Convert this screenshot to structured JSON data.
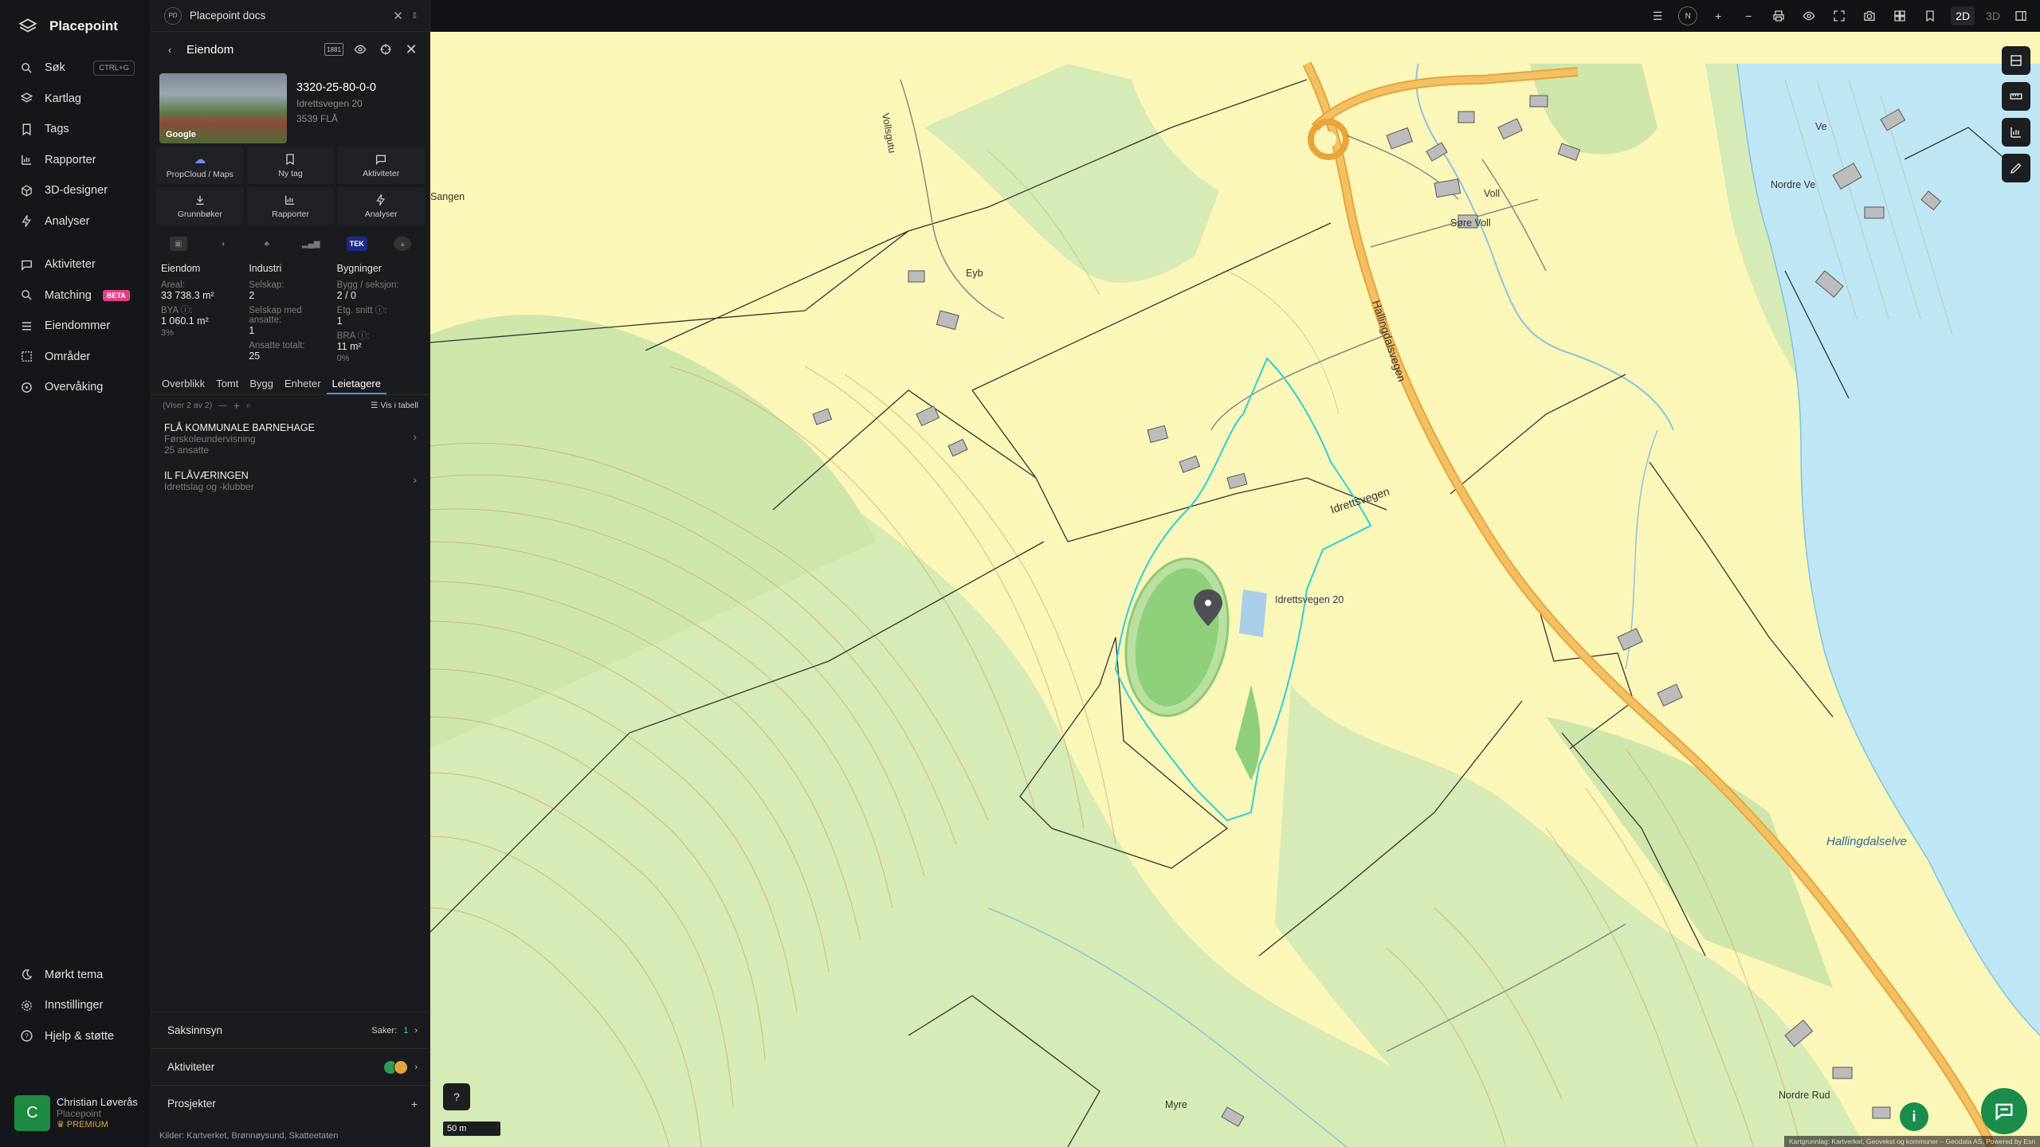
{
  "app": {
    "name": "Placepoint"
  },
  "nav": {
    "items": [
      {
        "label": "Søk",
        "shortcut": "CTRL+G"
      },
      {
        "label": "Kartlag"
      },
      {
        "label": "Tags"
      },
      {
        "label": "Rapporter"
      },
      {
        "label": "3D-designer"
      },
      {
        "label": "Analyser"
      },
      {
        "label": "Aktiviteter"
      },
      {
        "label": "Matching",
        "badge": "BETA"
      },
      {
        "label": "Eiendommer"
      },
      {
        "label": "Områder"
      },
      {
        "label": "Overvåking"
      }
    ],
    "bottom": [
      {
        "label": "Mørkt tema"
      },
      {
        "label": "Innstillinger"
      },
      {
        "label": "Hjelp & støtte"
      }
    ],
    "user": {
      "initial": "C",
      "name": "Christian Løverås",
      "org": "Placepoint",
      "plan": "PREMIUM"
    }
  },
  "panel": {
    "docs": {
      "badge": "PD",
      "title": "Placepoint docs"
    },
    "header": {
      "title": "Eiendom",
      "code_badge": "1881"
    },
    "property": {
      "id": "3320-25-80-0-0",
      "address": "Idrettsvegen 20",
      "postal": "3539 FLÅ",
      "thumb_label": "Google"
    },
    "actions": [
      "PropCloud / Maps",
      "Ny tag",
      "Aktiviteter",
      "Grunnbøker",
      "Rapporter",
      "Analyser"
    ],
    "source_tek": "TEK",
    "stats": {
      "eiendom": {
        "heading": "Eiendom",
        "areal_label": "Areal:",
        "areal": "33 738.3 m²",
        "bya_label": "BYA ⓘ:",
        "bya": "1 060.1 m²",
        "bya_pct": "3%"
      },
      "industri": {
        "heading": "Industri",
        "selskap_label": "Selskap:",
        "selskap": "2",
        "ansatte_label": "Selskap med ansatte:",
        "ansatte": "1",
        "ansatte_totalt_label": "Ansatte totalt:",
        "ansatte_totalt": "25"
      },
      "bygninger": {
        "heading": "Bygninger",
        "bygg_label": "Bygg / seksjon:",
        "bygg": "2 / 0",
        "etg_label": "Etg. snitt ⓘ:",
        "etg": "1",
        "bra_label": "BRA ⓘ:",
        "bra": "11 m²",
        "bra_pct": "0%"
      }
    },
    "tabs": [
      "Overblikk",
      "Tomt",
      "Bygg",
      "Enheter",
      "Leietagere"
    ],
    "active_tab": "Leietagere",
    "list": {
      "count": "(Viser 2 av 2)",
      "table_label": "Vis i tabell"
    },
    "tenants": [
      {
        "name": "FLÅ KOMMUNALE BARNEHAGE",
        "industry": "Førskoleundervisning",
        "employees": "25 ansatte"
      },
      {
        "name": "IL FLÅVÆRINGEN",
        "industry": "Idrettslag og -klubber",
        "employees": ""
      }
    ],
    "bottom": {
      "saksinnsyn": {
        "label": "Saksinnsyn",
        "count_label": "Saker:",
        "count": "1"
      },
      "aktiviteter": {
        "label": "Aktiviteter"
      },
      "prosjekter": {
        "label": "Prosjekter",
        "add": "+"
      }
    },
    "kilder": {
      "label": "Kilder:",
      "sources": "Kartverket, Brønnøysund, Skatteetaten"
    }
  },
  "topbar": {
    "north": "N",
    "mode_2d": "2D",
    "mode_3d": "3D"
  },
  "map": {
    "labels": [
      {
        "text": "Voll"
      },
      {
        "text": "Søre Voll"
      },
      {
        "text": "Vollsgutu"
      },
      {
        "text": "Eyb"
      },
      {
        "text": "Sangen"
      },
      {
        "text": "Ve"
      },
      {
        "text": "Nordre Ve"
      },
      {
        "text": "Idrettsvegen"
      },
      {
        "text": "Hallingdalsvegen"
      },
      {
        "text": "Hallingdalselve"
      },
      {
        "text": "Nordre Rud"
      },
      {
        "text": "Myre"
      },
      {
        "text": "Idrettsvegen 20"
      }
    ],
    "scale": "50 m",
    "attribution": "Kartgrunnlag: Kartverket, Geovekst og kommuner – Geodata AS, Powered by Esri"
  },
  "colors": {
    "accent": "#4a90d9",
    "brand_green": "#1a8d4c",
    "beta": "#e23f86",
    "map_yellow": "#fbf7b8",
    "map_green": "#d6ebb5",
    "water": "#bfe6f5",
    "road": "#e8a53a"
  }
}
